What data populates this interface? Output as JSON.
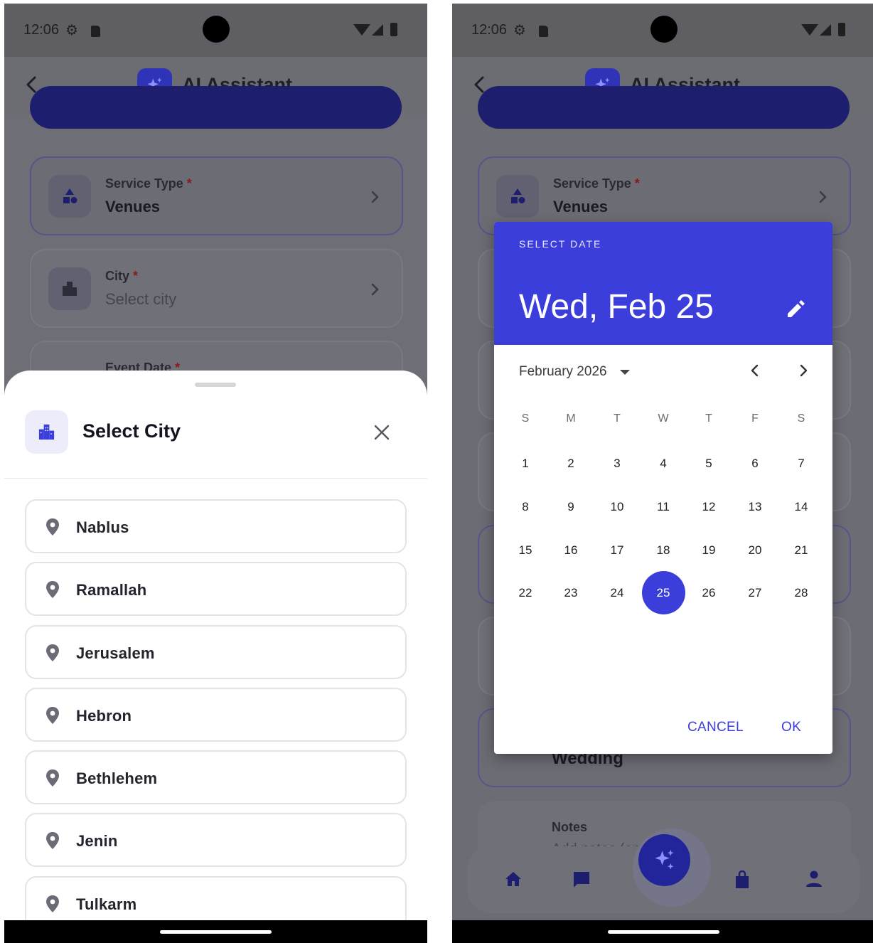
{
  "status_bar": {
    "time": "12:06"
  },
  "app_bar": {
    "title": "AI Assistant"
  },
  "left_screen": {
    "fields": [
      {
        "label": "Service Type",
        "required_mark": "*",
        "value": "Venues"
      },
      {
        "label": "City",
        "required_mark": "*",
        "value": "Select city"
      },
      {
        "label": "Event Date",
        "required_mark": "*",
        "value": ""
      }
    ],
    "sheet": {
      "title": "Select City",
      "cities": [
        "Nablus",
        "Ramallah",
        "Jerusalem",
        "Hebron",
        "Bethlehem",
        "Jenin",
        "Tulkarm"
      ]
    }
  },
  "right_screen": {
    "fields": [
      {
        "label": "Service Type",
        "required_mark": "*",
        "value": "Venues"
      }
    ],
    "partial_text": "Wedding",
    "notes": {
      "label": "Notes",
      "placeholder": "Add notes (optional)"
    },
    "date_picker": {
      "caption": "SELECT DATE",
      "selected_date": "Wed, Feb 25",
      "month_label": "February 2026",
      "weekdays": [
        "S",
        "M",
        "T",
        "W",
        "T",
        "F",
        "S"
      ],
      "weeks": [
        [
          "1",
          "2",
          "3",
          "4",
          "5",
          "6",
          "7"
        ],
        [
          "8",
          "9",
          "10",
          "11",
          "12",
          "13",
          "14"
        ],
        [
          "15",
          "16",
          "17",
          "18",
          "19",
          "20",
          "21"
        ],
        [
          "22",
          "23",
          "24",
          "25",
          "26",
          "27",
          "28"
        ]
      ],
      "selected_day": "25",
      "cancel_label": "CANCEL",
      "ok_label": "OK"
    }
  },
  "colors": {
    "accent": "#3c3edc",
    "brand_dark": "#2f33b8",
    "required": "#e53935"
  },
  "icons": {
    "back": "chevron-left-icon",
    "logo": "sparkles-icon",
    "service": "shapes-icon",
    "city": "city-icon",
    "close": "close-icon",
    "pin": "location-pin-icon",
    "edit": "pencil-icon",
    "nav": [
      "home-icon",
      "chat-icon",
      "sparkles-icon",
      "shopping-bag-icon",
      "person-icon"
    ]
  }
}
